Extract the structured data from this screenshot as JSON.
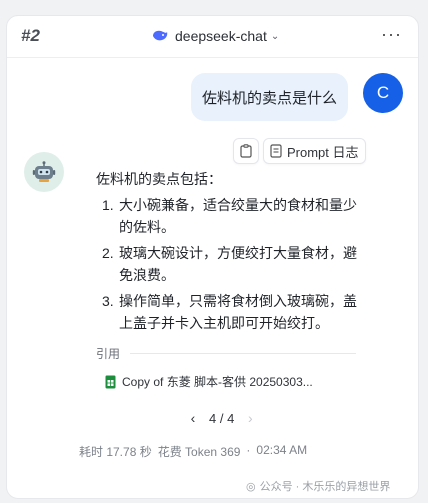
{
  "header": {
    "chat_number": "#2",
    "model_name": "deepseek-chat",
    "more_label": "···"
  },
  "user": {
    "message": "佐料机的卖点是什么",
    "avatar_letter": "C"
  },
  "actions": {
    "prompt_label": "Prompt 日志"
  },
  "answer": {
    "intro": "佐料机的卖点包括：",
    "items": [
      {
        "num": "1.",
        "text": "大小碗兼备，适合绞量大的食材和量少的佐料。"
      },
      {
        "num": "2.",
        "text": "玻璃大碗设计，方便绞打大量食材，避免浪费。"
      },
      {
        "num": "3.",
        "text": "操作简单，只需将食材倒入玻璃碗，盖上盖子并卡入主机即可开始绞打。"
      }
    ]
  },
  "citation": {
    "label": "引用",
    "reference": "Copy of 东菱 脚本-客供 20250303..."
  },
  "pager": {
    "page": "4 / 4",
    "prev": "‹",
    "next": "›"
  },
  "footer": {
    "time": "耗时 17.78 秒",
    "tokens": "花费 Token 369",
    "sep": "·",
    "timestamp": "02:34 AM"
  },
  "watermark": {
    "text": "公众号 · 木乐乐的异想世界"
  },
  "colors": {
    "accent": "#1560e6",
    "user_bubble": "#e8f1fc",
    "sheet_icon": "#1e8e3e"
  }
}
